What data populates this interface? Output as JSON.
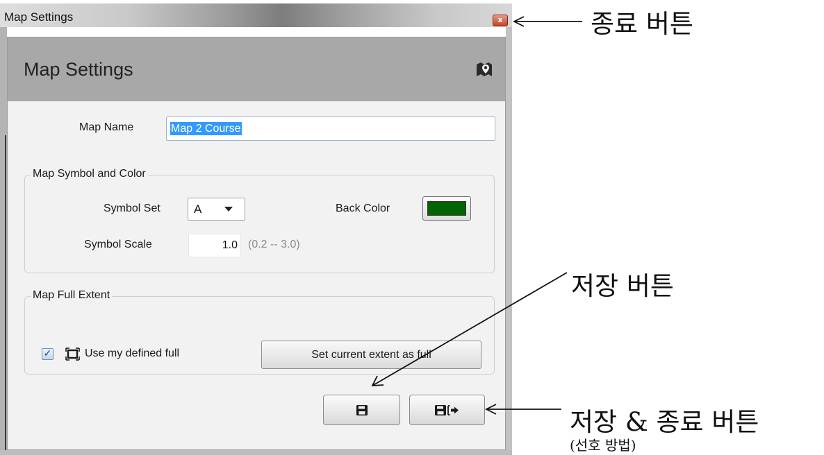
{
  "window": {
    "title": "Map Settings",
    "close_glyph": "x"
  },
  "panel": {
    "title": "Map Settings",
    "icon": "map-marker-icon"
  },
  "map_name": {
    "label": "Map Name",
    "value": "Map 2 Course"
  },
  "symbol_group": {
    "title": "Map Symbol and Color",
    "symbol_set_label": "Symbol Set",
    "symbol_set_value": "A",
    "back_color_label": "Back Color",
    "back_color": "#006400",
    "symbol_scale_label": "Symbol Scale",
    "symbol_scale_value": "1.0",
    "symbol_scale_range": "(0.2 -- 3.0)"
  },
  "extent_group": {
    "title": "Map Full Extent",
    "use_full_checked": true,
    "use_full_label": "Use my defined full",
    "set_extent_button": "Set current extent as full"
  },
  "buttons": {
    "save_icon": "floppy-disk-icon",
    "save_close_icon": "floppy-disk-exit-icon"
  },
  "annotations": {
    "close_button": "종료 버튼",
    "save_button": "저장 버튼",
    "save_close_button": "저장 & 종료 버튼",
    "preferred": "(선호 방법)"
  },
  "colors": {
    "header_gray": "#a8a8a8",
    "panel_bg": "#f2f2f2",
    "selection_blue": "#3399ff",
    "back_color_green": "#006400"
  }
}
